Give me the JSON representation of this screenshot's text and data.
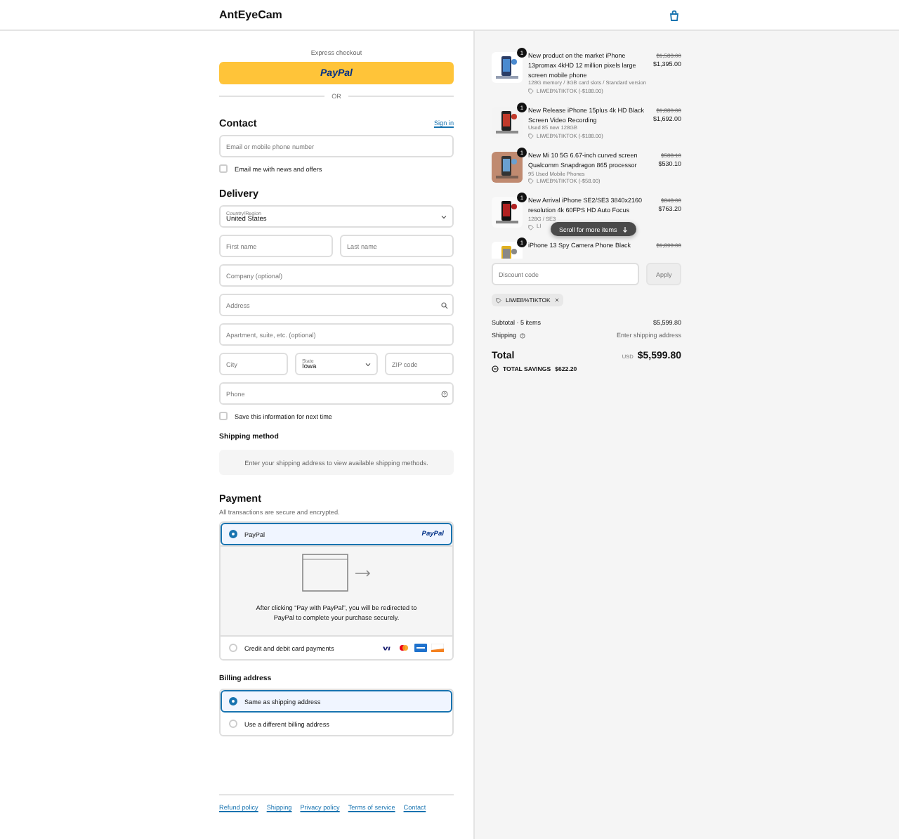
{
  "header": {
    "brand": "AntEyeCam"
  },
  "express": {
    "label": "Express checkout",
    "button": "PayPal",
    "divider": "OR"
  },
  "contact": {
    "title": "Contact",
    "link": "Sign in",
    "email": {
      "placeholder": "Email or mobile phone number"
    },
    "newsletter": {
      "label": "Email me with news and offers",
      "checked": false
    }
  },
  "delivery": {
    "title": "Delivery",
    "rows": [
      [
        {
          "kind": "select",
          "label": "Country/Region",
          "value": "United States"
        }
      ],
      [
        {
          "kind": "text",
          "placeholder": "First name"
        },
        {
          "kind": "text",
          "placeholder": "Last name"
        }
      ],
      [
        {
          "kind": "text",
          "placeholder": "Company (optional)"
        }
      ],
      [
        {
          "kind": "search",
          "placeholder": "Address"
        }
      ],
      [
        {
          "kind": "text",
          "placeholder": "Apartment, suite, etc. (optional)"
        }
      ],
      [
        {
          "kind": "text",
          "placeholder": "City"
        },
        {
          "kind": "select",
          "label": "State",
          "value": "Iowa"
        },
        {
          "kind": "text",
          "placeholder": "ZIP code"
        }
      ],
      [
        {
          "kind": "help",
          "placeholder": "Phone"
        }
      ]
    ],
    "save": {
      "label": "Save this information for next time",
      "checked": false
    }
  },
  "shipping_method": {
    "title": "Shipping method",
    "note": "Enter your shipping address to view available shipping methods."
  },
  "payment": {
    "title": "Payment",
    "subtitle": "All transactions are secure and encrypted.",
    "options": [
      {
        "kind": "paypal",
        "label": "PayPal",
        "logo": "PayPal",
        "selected": true
      },
      {
        "kind": "cards",
        "label": "Credit and debit card payments",
        "selected": false
      }
    ],
    "redirect_note": "After clicking “Pay with PayPal”, you will be redirected to PayPal to complete your purchase securely."
  },
  "billing": {
    "title": "Billing address",
    "options": [
      {
        "label": "Same as shipping address",
        "selected": true
      },
      {
        "label": "Use a different billing address",
        "selected": false
      }
    ]
  },
  "footer_links": [
    "Refund policy",
    "Shipping",
    "Privacy policy",
    "Terms of service",
    "Contact"
  ],
  "order": {
    "items": [
      {
        "quantity": "1",
        "title": "New product on the market iPhone 13promax 4kHD 12 million pixels large screen mobile phone",
        "variant": "128G memory / 3GB card slots / Standard version",
        "discount": "LIWEB%TIKTOK (-$188.00)",
        "compare_price": "$1,583.00",
        "price": "$1,395.00"
      },
      {
        "quantity": "1",
        "title": "New Release iPhone 15plus 4k HD Black Screen Video Recording",
        "variant": "Used 85 new 128GB",
        "discount": "LIWEB%TIKTOK (-$188.00)",
        "compare_price": "$1,880.00",
        "price": "$1,692.00"
      },
      {
        "quantity": "1",
        "title": "New Mi 10 5G 6.67-inch curved screen Qualcomm Snapdragon 865 processor",
        "variant": "95 Used Mobile Phones",
        "discount": "LIWEB%TIKTOK (-$58.00)",
        "compare_price": "$588.10",
        "price": "$530.10"
      },
      {
        "quantity": "1",
        "title": "New Arrival iPhone SE2/SE3 3840x2160 resolution 4k 60FPS HD Auto Focus",
        "variant": "128G / SE3",
        "discount": "LI",
        "compare_price": "$848.00",
        "price": "$763.20"
      },
      {
        "quantity": "1",
        "title": "iPhone 13 Spy Camera Phone Black",
        "compare_price": "$1,899.00"
      }
    ],
    "scroll_hint": "Scroll for more items",
    "discount": {
      "placeholder": "Discount code",
      "button": "Apply"
    },
    "applied_code": "LIWEB%TIKTOK",
    "subtotal": {
      "label": "Subtotal · 5 items",
      "value": "$5,599.80"
    },
    "shipping": {
      "label": "Shipping",
      "value": "Enter shipping address"
    },
    "total": {
      "label": "Total",
      "currency": "USD",
      "value": "$5,599.80"
    },
    "savings": {
      "label": "TOTAL SAVINGS",
      "value": "$622.20"
    }
  }
}
